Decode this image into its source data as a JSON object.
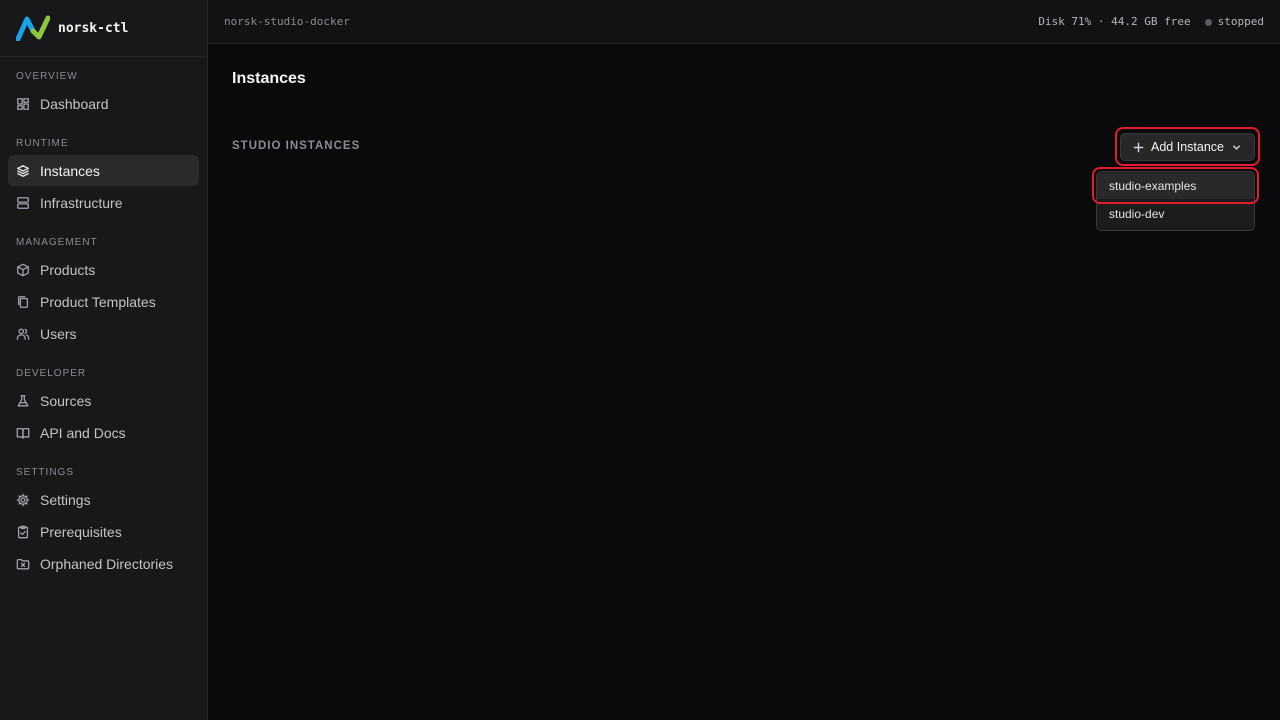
{
  "brand": {
    "name": "norsk-ctl"
  },
  "topbar": {
    "project": "norsk-studio-docker",
    "disk": "Disk 71% · 44.2 GB free",
    "status": "stopped"
  },
  "sidebar": {
    "sections": {
      "overview": "OVERVIEW",
      "runtime": "RUNTIME",
      "management": "MANAGEMENT",
      "developer": "DEVELOPER",
      "settings": "SETTINGS"
    },
    "items": {
      "dashboard": "Dashboard",
      "instances": "Instances",
      "infrastructure": "Infrastructure",
      "products": "Products",
      "product_templates": "Product Templates",
      "users": "Users",
      "sources": "Sources",
      "api_docs": "API and Docs",
      "settings": "Settings",
      "prerequisites": "Prerequisites",
      "orphaned": "Orphaned Directories"
    },
    "active": "Instances"
  },
  "main": {
    "title": "Instances",
    "section_label": "STUDIO INSTANCES",
    "add_button": "Add Instance",
    "dropdown": [
      "studio-examples",
      "studio-dev"
    ]
  },
  "colors": {
    "highlight": "#e11d2a",
    "brand_blue": "#1aa3e8",
    "brand_green": "#8cc63f"
  }
}
